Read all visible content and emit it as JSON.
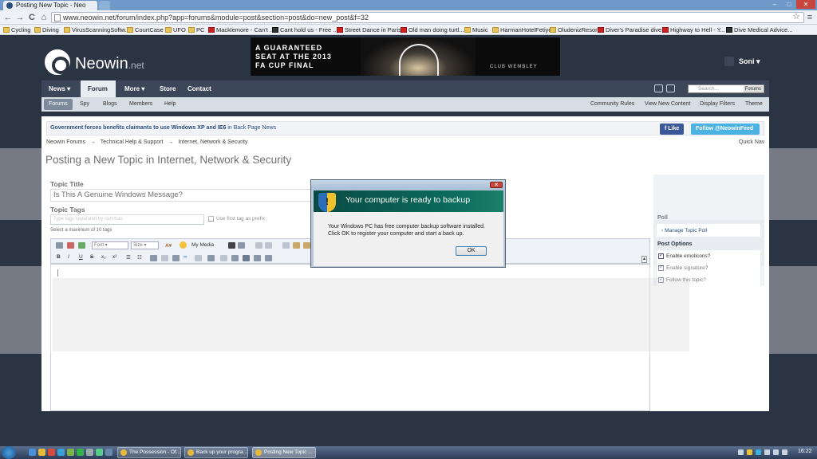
{
  "browser": {
    "tabs": [
      {
        "label": "Posting New Topic - Neo",
        "active": true
      }
    ],
    "url": "www.neowin.net/forum/index.php?app=forums&module=post&section=post&do=new_post&f=32",
    "window_controls": {
      "minimize": "–",
      "maximize": "□",
      "close": "✕"
    },
    "nav": {
      "back": "←",
      "forward": "→",
      "reload": "C",
      "home": "⌂",
      "star": "☆",
      "menu": "≡"
    },
    "bookmarks": [
      {
        "label": "Cycling",
        "icon": "folder-icon"
      },
      {
        "label": "Diving",
        "icon": "folder-icon"
      },
      {
        "label": "VirusScanningSoftw...",
        "icon": "folder-icon"
      },
      {
        "label": "CourtCase",
        "icon": "folder-icon"
      },
      {
        "label": "UFO",
        "icon": "folder-icon"
      },
      {
        "label": "PC",
        "icon": "folder-icon"
      },
      {
        "label": "Macklemore - Can't ...",
        "icon": "page-icon"
      },
      {
        "label": "Cant hold us - Free ...",
        "icon": "page-icon"
      },
      {
        "label": "Street Dance in Paris...",
        "icon": "youtube-icon"
      },
      {
        "label": "Old man doing turtl...",
        "icon": "youtube-icon"
      },
      {
        "label": "Music",
        "icon": "folder-icon"
      },
      {
        "label": "HarmanHotelFetiye",
        "icon": "folder-icon"
      },
      {
        "label": "OludenizResort",
        "icon": "folder-icon"
      },
      {
        "label": "Diver's Paradise dive...",
        "icon": "page-icon"
      },
      {
        "label": "Highway to Hell - Y...",
        "icon": "youtube-icon"
      },
      {
        "label": "Dive Medical Advice...",
        "icon": "page-icon"
      }
    ]
  },
  "ad": {
    "headline": "A GUARANTEED SEAT AT THE 2013 FA CUP FINAL",
    "line1": "A GUARANTEED",
    "line2": "SEAT AT THE 2013",
    "line3": "FA CUP FINAL",
    "brand": "CLUB WEMBLEY"
  },
  "site": {
    "brand": "Neowin",
    "brand_suffix": ".net",
    "user": "Soni",
    "main_nav": [
      {
        "label": "News ▾",
        "active": false
      },
      {
        "label": "Forum ▾",
        "active": true
      },
      {
        "label": "More ▾",
        "active": false
      },
      {
        "label": "Store",
        "active": false
      },
      {
        "label": "Contact",
        "active": false
      }
    ],
    "search": {
      "placeholder": "Search...",
      "scope": "Forums"
    },
    "sub_nav": [
      "Forums",
      "Spy",
      "Blogs",
      "Members",
      "Help"
    ],
    "sub_nav_right": [
      "Community Rules",
      "View New Content",
      "Display Filters",
      "Theme"
    ]
  },
  "board": {
    "news": "Government forces benefits claimants to use Windows XP and IE6",
    "news_suffix": "in Back Page News",
    "like": "Like",
    "follow": "Follow @NeowinFeed"
  },
  "breadcrumb": {
    "items": [
      "Neowin Forums",
      "Technical Help & Support",
      "Internet, Network & Security"
    ],
    "sep": "→",
    "quick_nav": "Quick Nav"
  },
  "page": {
    "title": "Posting a New Topic in Internet, Network & Security"
  },
  "form": {
    "topic_title_label": "Topic Title",
    "topic_title_value": "Is This A Genuine Windows Message?",
    "topic_tags_label": "Topic Tags",
    "tags_placeholder": "Type tags separated by commas",
    "first_tag_prefix": "Use first tag as prefix",
    "max_tags": "Select a maximum of 10 tags"
  },
  "editor": {
    "font_select": "Font",
    "size_select": "Size",
    "my_media": "My Media"
  },
  "sidebar": {
    "poll_label": "Poll",
    "manage_poll": "Manage Topic Poll",
    "post_options_label": "Post Options",
    "options": [
      {
        "label": "Enable emoticons?",
        "checked": true
      },
      {
        "label": "Enable signature?",
        "checked": true
      },
      {
        "label": "Follow this topic?",
        "checked": true
      }
    ]
  },
  "dialog": {
    "title": "Your computer is ready to backup",
    "message": "Your Windows PC has free computer backup software installed. Click OK to register your computer and start a back up.",
    "ok": "OK",
    "close": "✕"
  },
  "taskbar": {
    "tasks": [
      {
        "label": "The Possession - Of..."
      },
      {
        "label": "Back up your progra..."
      },
      {
        "label": "Posting New Topic ..."
      }
    ],
    "clock": "16:22"
  },
  "colors": {
    "page_bg": "#2b3442",
    "accent_link": "#2d4e7e",
    "facebook": "#3b5998",
    "twitter": "#4bb3e3",
    "dialog_header": "#0b6a5a"
  }
}
